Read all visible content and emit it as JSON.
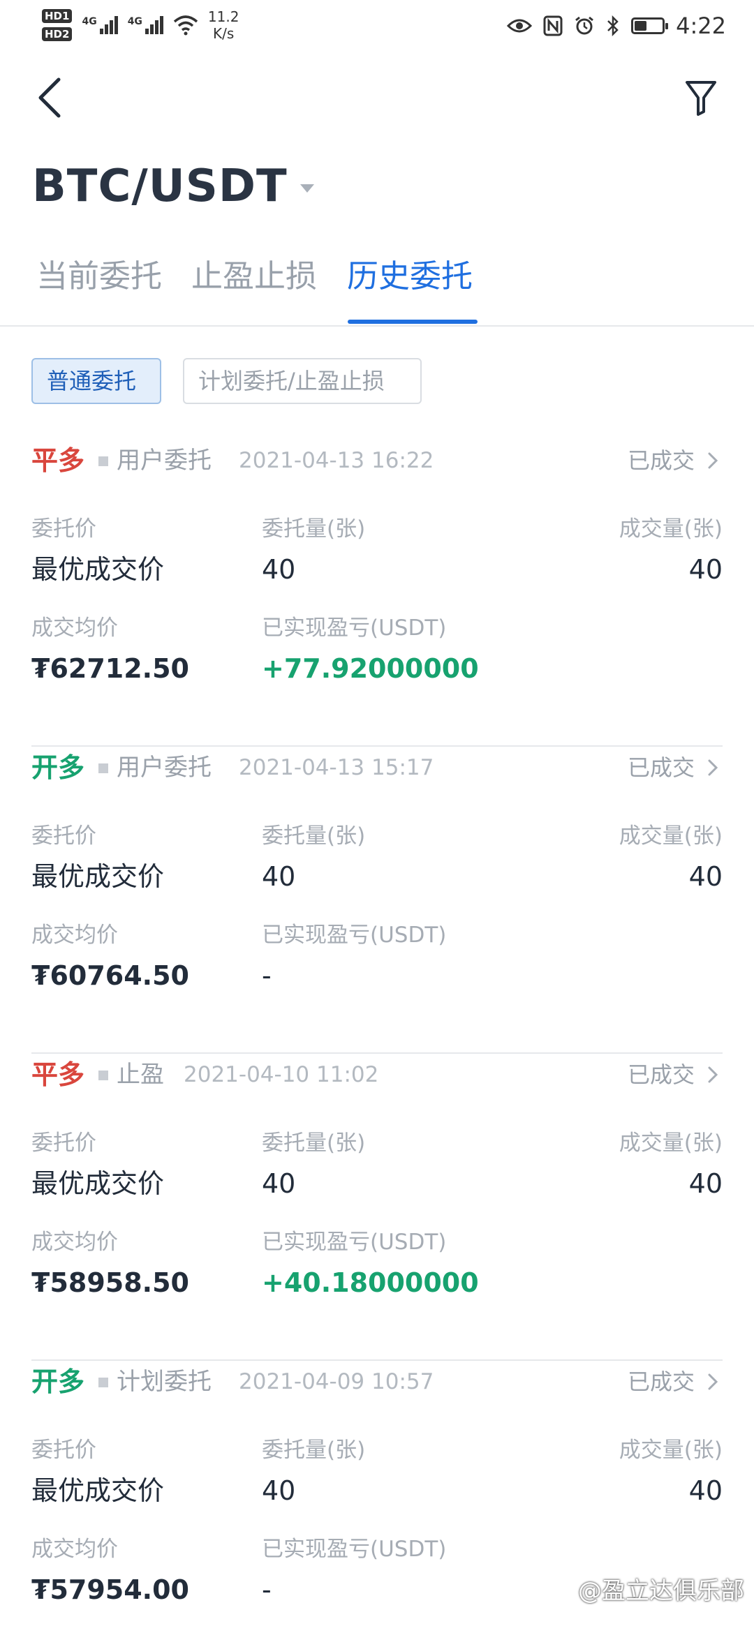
{
  "status_bar": {
    "hd_badges": [
      "HD1",
      "HD2"
    ],
    "network_1": "4G",
    "network_2": "4G",
    "speed_value": "11.2",
    "speed_unit": "K/s",
    "time": "4:22",
    "battery_level": 0.45,
    "icons": [
      "eye-icon",
      "nfc-icon",
      "alarm-icon",
      "bluetooth-icon",
      "battery-icon"
    ]
  },
  "header": {
    "pair": "BTC/USDT"
  },
  "tabs": [
    {
      "label": "当前委托",
      "active": false
    },
    {
      "label": "止盈止损",
      "active": false
    },
    {
      "label": "历史委托",
      "active": true
    }
  ],
  "chips": [
    {
      "label": "普通委托",
      "active": true
    },
    {
      "label": "计划委托/止盈止损",
      "active": false
    }
  ],
  "orders": [
    {
      "side": "平多",
      "side_kind": "close",
      "type": "用户委托",
      "time": "2021-04-13 16:22",
      "status": "已成交",
      "price_label": "委托价",
      "price": "最优成交价",
      "qty_label": "委托量(张)",
      "qty": "40",
      "filled_label": "成交量(张)",
      "filled": "40",
      "avg_label": "成交均价",
      "avg": "₮62712.50",
      "pnl_label": "已实现盈亏(USDT)",
      "pnl": "+77.92000000"
    },
    {
      "side": "开多",
      "side_kind": "open",
      "type": "用户委托",
      "time": "2021-04-13 15:17",
      "status": "已成交",
      "price_label": "委托价",
      "price": "最优成交价",
      "qty_label": "委托量(张)",
      "qty": "40",
      "filled_label": "成交量(张)",
      "filled": "40",
      "avg_label": "成交均价",
      "avg": "₮60764.50",
      "pnl_label": "已实现盈亏(USDT)",
      "pnl": "-"
    },
    {
      "side": "平多",
      "side_kind": "close",
      "type": "止盈",
      "time": "2021-04-10 11:02",
      "status": "已成交",
      "price_label": "委托价",
      "price": "最优成交价",
      "qty_label": "委托量(张)",
      "qty": "40",
      "filled_label": "成交量(张)",
      "filled": "40",
      "avg_label": "成交均价",
      "avg": "₮58958.50",
      "pnl_label": "已实现盈亏(USDT)",
      "pnl": "+40.18000000"
    },
    {
      "side": "开多",
      "side_kind": "open",
      "type": "计划委托",
      "time": "2021-04-09 10:57",
      "status": "已成交",
      "price_label": "委托价",
      "price": "最优成交价",
      "qty_label": "委托量(张)",
      "qty": "40",
      "filled_label": "成交量(张)",
      "filled": "40",
      "avg_label": "成交均价",
      "avg": "₮57954.00",
      "pnl_label": "已实现盈亏(USDT)",
      "pnl": "-"
    }
  ],
  "watermark": "@盈立达俱乐部",
  "colors": {
    "accent_blue": "#1f6fe0",
    "close_red": "#d9463d",
    "open_green": "#17a26f"
  }
}
